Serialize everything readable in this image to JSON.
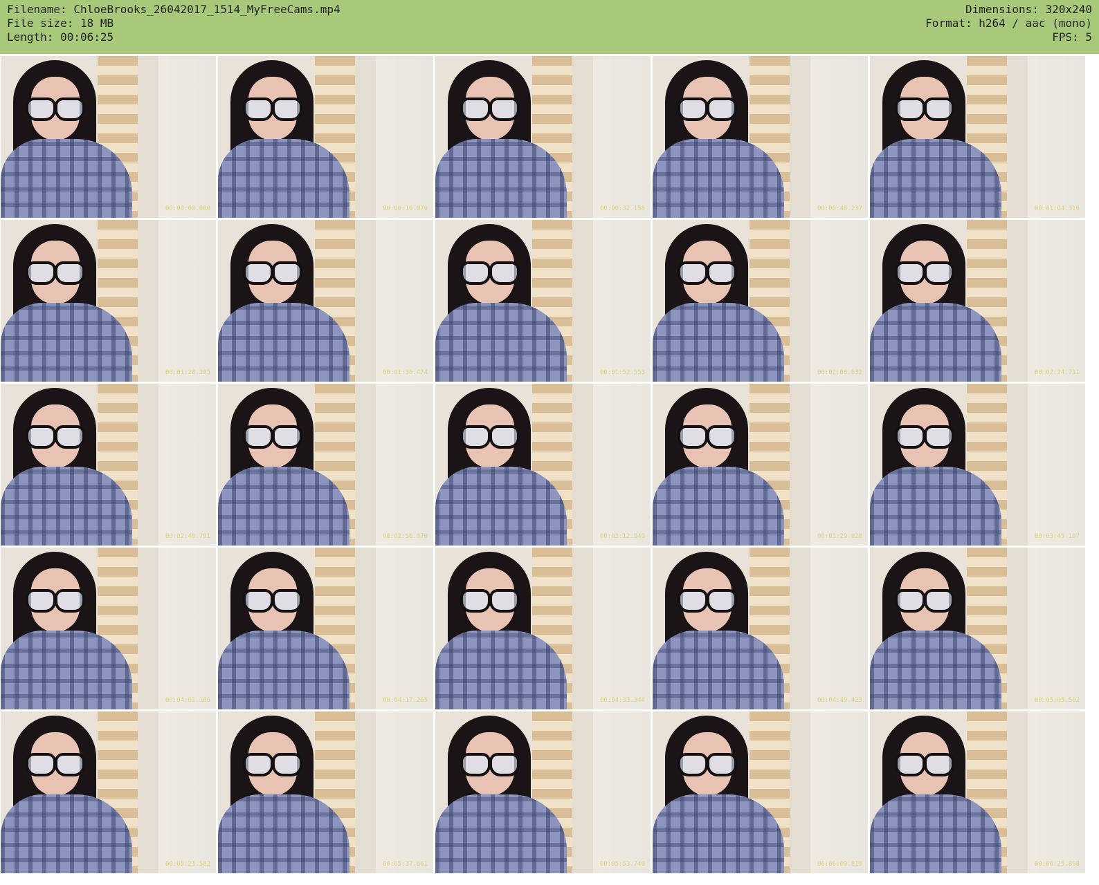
{
  "header": {
    "filename_line": "Filename: ChloeBrooks_26042017_1514_MyFreeCams.mp4",
    "filesize_line": "File size: 18 MB",
    "length_line": "Length: 00:06:25",
    "dimensions_line": "Dimensions: 320x240",
    "format_line": "Format: h264 / aac (mono)",
    "fps_line": "FPS: 5"
  },
  "colors": {
    "header_bg": "#a9c97a",
    "timestamp": "#d9d26d"
  },
  "thumbnails": [
    {
      "timestamp": "00:00:00.000"
    },
    {
      "timestamp": "00:00:16.079"
    },
    {
      "timestamp": "00:00:32.158"
    },
    {
      "timestamp": "00:00:48.237"
    },
    {
      "timestamp": "00:01:04.316"
    },
    {
      "timestamp": "00:01:20.395"
    },
    {
      "timestamp": "00:01:36.474"
    },
    {
      "timestamp": "00:01:52.553"
    },
    {
      "timestamp": "00:02:08.632"
    },
    {
      "timestamp": "00:02:24.711"
    },
    {
      "timestamp": "00:02:40.791"
    },
    {
      "timestamp": "00:02:56.870"
    },
    {
      "timestamp": "00:03:12.949"
    },
    {
      "timestamp": "00:03:29.028"
    },
    {
      "timestamp": "00:03:45.107"
    },
    {
      "timestamp": "00:04:01.186"
    },
    {
      "timestamp": "00:04:17.265"
    },
    {
      "timestamp": "00:04:33.344"
    },
    {
      "timestamp": "00:04:49.423"
    },
    {
      "timestamp": "00:05:05.502"
    },
    {
      "timestamp": "00:05:21.582"
    },
    {
      "timestamp": "00:05:37.661"
    },
    {
      "timestamp": "00:05:53.740"
    },
    {
      "timestamp": "00:06:09.819"
    },
    {
      "timestamp": "00:06:25.898"
    }
  ]
}
